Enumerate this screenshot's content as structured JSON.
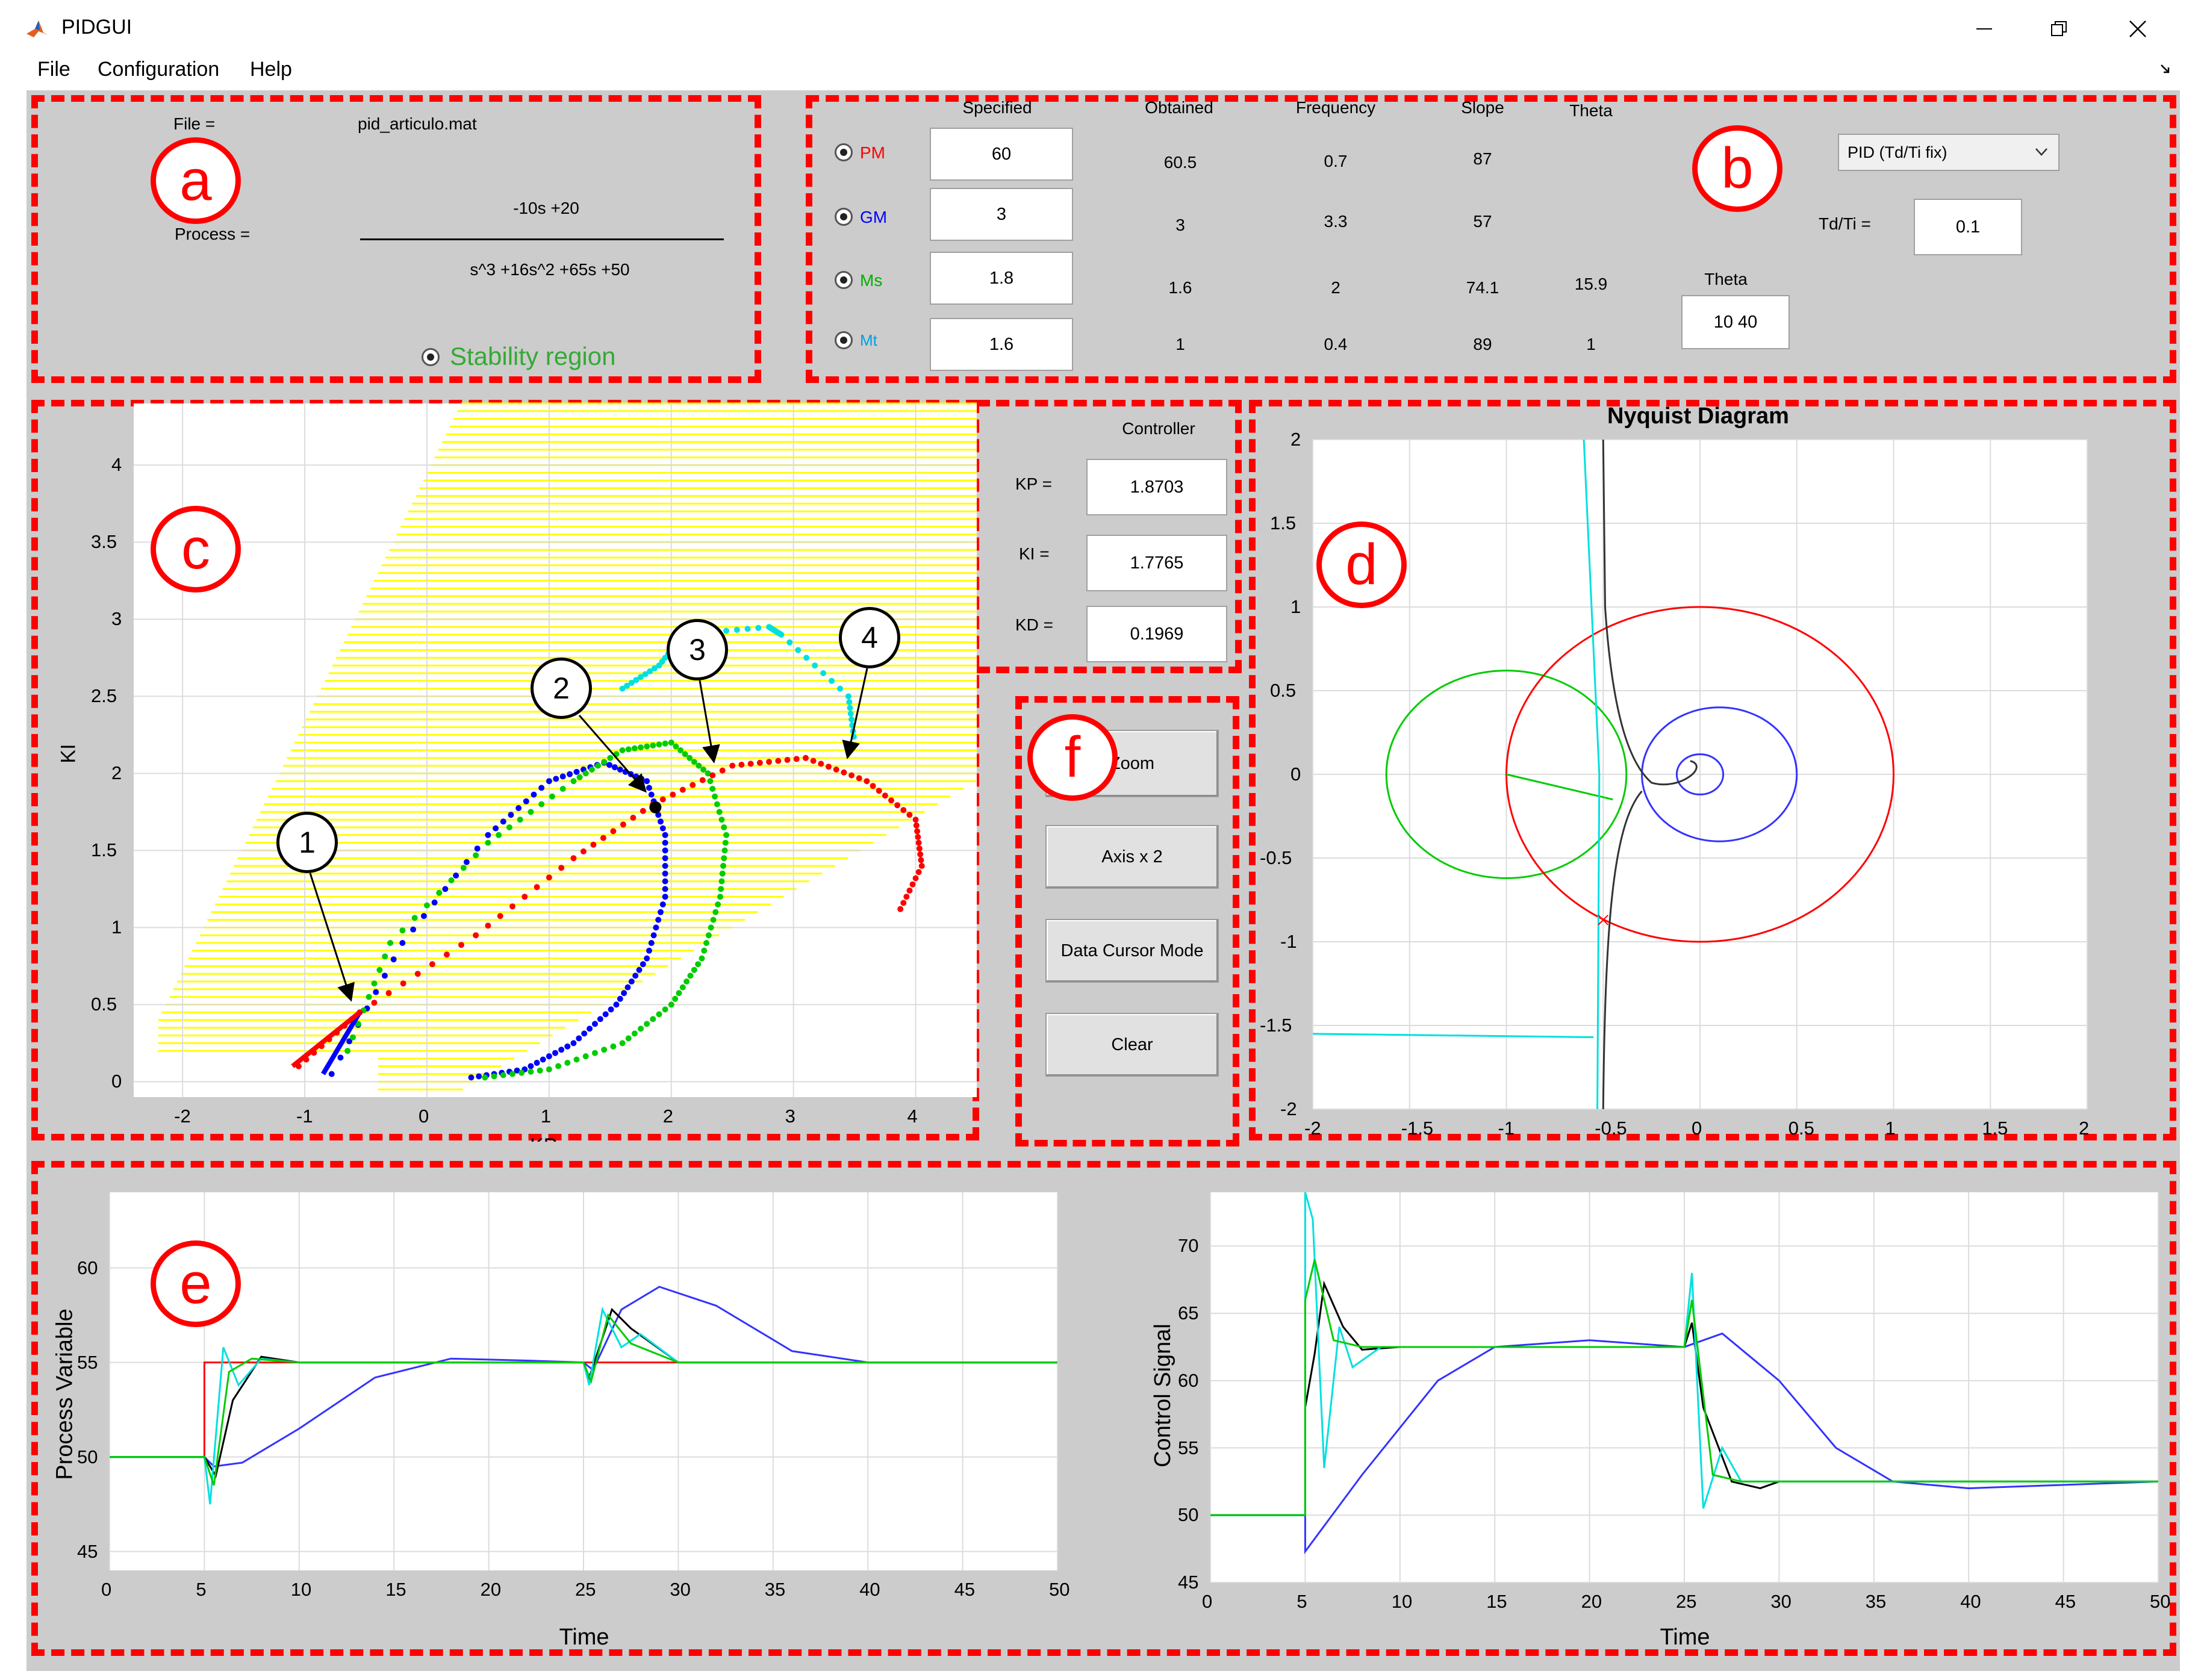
{
  "window": {
    "title": "PIDGUI"
  },
  "menu": {
    "items": [
      "File",
      "Configuration",
      "Help"
    ]
  },
  "panels": {
    "a": "a",
    "b": "b",
    "c": "c",
    "d": "d",
    "e": "e",
    "f": "f"
  },
  "process_panel": {
    "file_label": "File =",
    "file_value": "pid_articulo.mat",
    "process_label": "Process =",
    "numerator": "-10s  +20",
    "denominator": "s^3 +16s^2 +65s  +50",
    "stability_label": "Stability region"
  },
  "spec_panel": {
    "headers": {
      "specified": "Specified",
      "obtained": "Obtained",
      "frequency": "Frequency",
      "slope": "Slope",
      "theta": "Theta"
    },
    "rows": [
      {
        "label": "PM",
        "color": "#ff0000",
        "specified": "60",
        "obtained": "60.5",
        "frequency": "0.7",
        "slope": "87",
        "theta": ""
      },
      {
        "label": "GM",
        "color": "#0000ff",
        "specified": "3",
        "obtained": "3",
        "frequency": "3.3",
        "slope": "57",
        "theta": ""
      },
      {
        "label": "Ms",
        "color": "#00b000",
        "specified": "1.8",
        "obtained": "1.6",
        "frequency": "2",
        "slope": "74.1",
        "theta": "15.9"
      },
      {
        "label": "Mt",
        "color": "#00a0e0",
        "specified": "1.6",
        "obtained": "1",
        "frequency": "0.4",
        "slope": "89",
        "theta": "1"
      }
    ],
    "controller_type": "PID (Td/Ti fix)",
    "tdti_label": "Td/Ti =",
    "tdti_value": "0.1",
    "theta_label": "Theta",
    "theta_value": "10  40"
  },
  "controller_panel": {
    "title": "Controller",
    "kp_label": "KP =",
    "kp_value": "1.8703",
    "ki_label": "KI =",
    "ki_value": "1.7765",
    "kd_label": "KD =",
    "kd_value": "0.1969"
  },
  "buttons": {
    "zoom": "Zoom",
    "axis": "Axis x 2",
    "datacursor": "Data Cursor Mode",
    "clear": "Clear"
  },
  "callouts": [
    "1",
    "2",
    "3",
    "4"
  ],
  "chart_data": [
    {
      "type": "scatter",
      "title": "",
      "xlabel": "KP",
      "ylabel": "KI",
      "xlim": [
        -2.4,
        4.5
      ],
      "ylim": [
        -0.1,
        4.4
      ],
      "xticks": [
        "-2",
        "-1",
        "0",
        "1",
        "2",
        "3",
        "4"
      ],
      "yticks": [
        "0",
        "0.5",
        "1",
        "1.5",
        "2",
        "2.5",
        "3",
        "3.5",
        "4"
      ],
      "grid": true,
      "stability_region_color": "#ffff00",
      "series": [
        {
          "color": "#0000ff",
          "x": [
            -0.78,
            -0.2,
            0.5,
            1.0,
            1.45,
            1.8,
            1.95,
            1.95,
            1.8,
            1.55,
            1.2,
            0.8,
            0.3
          ],
          "y": [
            0.05,
            0.9,
            1.6,
            1.95,
            2.07,
            1.95,
            1.6,
            1.2,
            0.8,
            0.5,
            0.25,
            0.08,
            0.02
          ]
        },
        {
          "color": "#00cc00",
          "x": [
            -0.65,
            -0.3,
            0.5,
            1.2,
            1.6,
            2.0,
            2.3,
            2.45,
            2.4,
            2.25,
            2.0,
            1.6,
            1.0,
            0.4
          ],
          "y": [
            0.2,
            0.9,
            1.55,
            1.95,
            2.15,
            2.2,
            2.0,
            1.6,
            1.2,
            0.8,
            0.5,
            0.25,
            0.08,
            0.02
          ]
        },
        {
          "color": "#ff0000",
          "x": [
            -1.05,
            -0.55,
            0.4,
            1.2,
            1.85,
            2.5,
            3.1,
            3.6,
            4.0,
            4.05,
            3.85
          ],
          "y": [
            0.1,
            0.45,
            0.95,
            1.45,
            1.8,
            2.05,
            2.1,
            1.95,
            1.7,
            1.4,
            1.08
          ]
        },
        {
          "color": "#00e0e0",
          "x": [
            1.6,
            1.9,
            2.1,
            2.8,
            2.9,
            3.45,
            3.5
          ],
          "y": [
            2.55,
            2.7,
            2.9,
            2.95,
            2.9,
            2.5,
            2.2
          ]
        }
      ],
      "marker": {
        "x": 1.87,
        "y": 1.78
      }
    },
    {
      "type": "line",
      "title": "Nyquist Diagram",
      "xlim": [
        -2,
        2
      ],
      "ylim": [
        -2,
        2
      ],
      "xticks": [
        "-2",
        "-1.5",
        "-1",
        "-0.5",
        "0",
        "0.5",
        "1",
        "1.5",
        "2"
      ],
      "yticks": [
        "-2",
        "-1.5",
        "-1",
        "-0.5",
        "0",
        "0.5",
        "1",
        "1.5",
        "2"
      ],
      "grid": true,
      "circles": [
        {
          "color": "#00cc00",
          "cx": -1.0,
          "cy": 0,
          "r": 0.62
        },
        {
          "color": "#ff0000",
          "cx": 0,
          "cy": 0,
          "r": 1.0
        },
        {
          "color": "#3333ff",
          "cx": 0.1,
          "cy": 0,
          "r": 0.4
        },
        {
          "color": "#3333ff",
          "cx": 0.0,
          "cy": 0,
          "r": 0.12
        }
      ]
    },
    {
      "type": "line",
      "xlabel": "Time",
      "ylabel": "Process Variable",
      "xlim": [
        0,
        50
      ],
      "ylim": [
        44,
        64
      ],
      "xticks": [
        "0",
        "5",
        "10",
        "15",
        "20",
        "25",
        "30",
        "35",
        "40",
        "45",
        "50"
      ],
      "yticks": [
        "45",
        "50",
        "55",
        "60"
      ],
      "grid": true,
      "series": [
        {
          "color": "#ff0000",
          "x": [
            0,
            5,
            5,
            25,
            25.5,
            26,
            50
          ],
          "y": [
            50,
            50,
            55,
            55,
            55,
            55,
            55
          ]
        },
        {
          "color": "#3333ff",
          "x": [
            0,
            5,
            5.5,
            7,
            10,
            14,
            18,
            22,
            25,
            25.5,
            27,
            29,
            32,
            36,
            40,
            50
          ],
          "y": [
            50,
            50,
            49.5,
            49.7,
            51.5,
            54.2,
            55.2,
            55.1,
            55,
            54.6,
            57.8,
            59,
            58,
            55.6,
            55,
            55
          ]
        },
        {
          "color": "#000000",
          "x": [
            0,
            5,
            5.6,
            6.5,
            8,
            10,
            25,
            25.3,
            26.5,
            27.5,
            30,
            50
          ],
          "y": [
            50,
            50,
            49,
            53,
            55.3,
            55,
            55,
            54.2,
            57.8,
            56.8,
            55,
            55
          ]
        },
        {
          "color": "#00e0e0",
          "x": [
            0,
            5,
            5.3,
            6,
            6.8,
            8,
            10,
            25,
            25.3,
            26,
            27,
            28,
            30,
            50
          ],
          "y": [
            50,
            50,
            47.5,
            55.8,
            53.8,
            55.2,
            55,
            55,
            53.8,
            57.8,
            55.8,
            56.5,
            55,
            55
          ]
        },
        {
          "color": "#00cc00",
          "x": [
            0,
            5,
            5.5,
            6.3,
            7.5,
            10,
            25,
            25.4,
            26.3,
            27.5,
            30,
            50
          ],
          "y": [
            50,
            50,
            48.5,
            54.5,
            55.2,
            55,
            55,
            54,
            57.5,
            56,
            55,
            55
          ]
        }
      ]
    },
    {
      "type": "line",
      "xlabel": "Time",
      "ylabel": "Control Signal",
      "xlim": [
        0,
        50
      ],
      "ylim": [
        45,
        74
      ],
      "xticks": [
        "0",
        "5",
        "10",
        "15",
        "20",
        "25",
        "30",
        "35",
        "40",
        "45",
        "50"
      ],
      "yticks": [
        "45",
        "50",
        "55",
        "60",
        "65",
        "70"
      ],
      "grid": true,
      "series": [
        {
          "color": "#000000",
          "x": [
            0,
            5,
            5,
            5.5,
            6,
            7,
            8,
            10,
            25,
            25.4,
            26,
            27.5,
            29,
            30,
            50
          ],
          "y": [
            50,
            50,
            58,
            62,
            67.2,
            64,
            62.3,
            62.5,
            62.5,
            64.3,
            58,
            52.5,
            52,
            52.5,
            52.5
          ]
        },
        {
          "color": "#3333ff",
          "x": [
            0,
            5,
            5,
            8,
            12,
            15,
            20,
            25,
            27,
            30,
            33,
            36,
            40,
            50
          ],
          "y": [
            50,
            50,
            47.3,
            53,
            60,
            62.5,
            63,
            62.5,
            63.5,
            60,
            55,
            52.5,
            52,
            52.5
          ]
        },
        {
          "color": "#00e0e0",
          "x": [
            0,
            5,
            5,
            5.4,
            6,
            6.8,
            7.5,
            9,
            25,
            25.4,
            26,
            27,
            28,
            30,
            50
          ],
          "y": [
            50,
            50,
            74,
            72,
            53.5,
            64,
            61,
            62.5,
            62.5,
            68,
            50.5,
            55,
            52.5,
            52.5,
            52.5
          ]
        },
        {
          "color": "#00cc00",
          "x": [
            0,
            5,
            5,
            5.5,
            6.5,
            8,
            25,
            25.4,
            26.5,
            28,
            50
          ],
          "y": [
            50,
            50,
            66,
            69,
            63,
            62.5,
            62.5,
            66,
            53,
            52.5,
            52.5
          ]
        }
      ]
    }
  ]
}
